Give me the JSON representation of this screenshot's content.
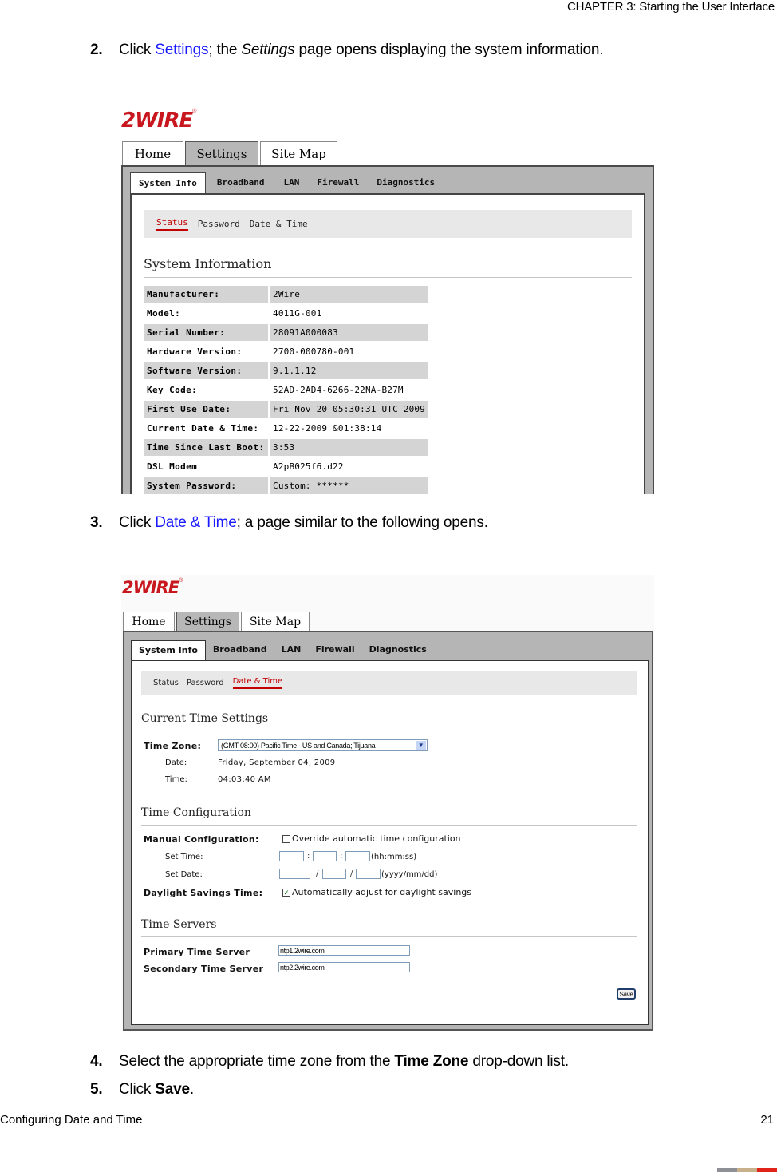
{
  "header": {
    "chapter": "CHAPTER 3: Starting the User Interface"
  },
  "steps": {
    "s2": {
      "num": "2.",
      "pre": "Click ",
      "link": "Settings",
      "mid": "; the ",
      "italic": "Settings",
      "post": " page opens displaying the system information."
    },
    "s3": {
      "num": "3.",
      "pre": "Click ",
      "link": "Date & Time",
      "post": "; a page similar to the following opens."
    },
    "s4": {
      "num": "4.",
      "pre": "Select the appropriate time zone from the ",
      "bold": "Time Zone",
      "post": " drop-down list."
    },
    "s5": {
      "num": "5.",
      "pre": "Click ",
      "bold": "Save",
      "post": "."
    }
  },
  "footer": {
    "left": "Configuring Date and Time",
    "page": "21",
    "bar_colors": [
      "#8f8f96",
      "#c8b08a",
      "#e2231a"
    ]
  },
  "brand": {
    "logo": "2WIRE",
    "reg": "®",
    "color": "#c8171e"
  },
  "screenshot1": {
    "top_tabs": [
      "Home",
      "Settings",
      "Site Map"
    ],
    "active_top_tab": "Settings",
    "sub_tabs": [
      "System Info",
      "Broadband",
      "LAN",
      "Firewall",
      "Diagnostics"
    ],
    "active_sub_tab": "System Info",
    "nav": [
      "Status",
      "Password",
      "Date & Time"
    ],
    "active_nav": "Status",
    "section_title": "System Information",
    "rows": [
      {
        "label": "Manufacturer:",
        "value": "2Wire"
      },
      {
        "label": "Model:",
        "value": "4011G-001"
      },
      {
        "label": "Serial Number:",
        "value": "28091A000083"
      },
      {
        "label": "Hardware Version:",
        "value": "2700-000780-001"
      },
      {
        "label": "Software Version:",
        "value": "9.1.1.12"
      },
      {
        "label": "Key Code:",
        "value": "52AD-2AD4-6266-22NA-B27M"
      },
      {
        "label": "First Use Date:",
        "value": "Fri Nov 20 05:30:31 UTC 2009"
      },
      {
        "label": "Current Date & Time:",
        "value": "12-22-2009 &01:38:14"
      },
      {
        "label": "Time Since Last Boot:",
        "value": "3:53"
      },
      {
        "label": "DSL Modem",
        "value": "A2pB025f6.d22"
      },
      {
        "label": "System Password:",
        "value": "Custom: ******"
      }
    ]
  },
  "screenshot2": {
    "top_tabs": [
      "Home",
      "Settings",
      "Site Map"
    ],
    "active_top_tab": "Settings",
    "sub_tabs": [
      "System Info",
      "Broadband",
      "LAN",
      "Firewall",
      "Diagnostics"
    ],
    "active_sub_tab": "System Info",
    "nav": [
      "Status",
      "Password",
      "Date & Time"
    ],
    "active_nav": "Date & Time",
    "current_time": {
      "title": "Current Time Settings",
      "time_zone_label": "Time Zone:",
      "time_zone_value": "(GMT-08:00) Pacific Time - US and Canada; Tijuana",
      "date_label": "Date:",
      "date_value": "Friday, September 04, 2009",
      "time_label": "Time:",
      "time_value": "04:03:40 AM"
    },
    "time_config": {
      "title": "Time Configuration",
      "manual_label": "Manual Configuration:",
      "override_label": "Override automatic time configuration",
      "override_checked": false,
      "set_time_label": "Set Time:",
      "time_sep": ":",
      "time_format": "(hh:mm:ss)",
      "set_date_label": "Set Date:",
      "date_sep": "/",
      "date_format": "(yyyy/mm/dd)",
      "dst_label": "Daylight Savings Time:",
      "dst_option": "Automatically adjust for daylight savings",
      "dst_checked": true,
      "check_glyph": "✓"
    },
    "time_servers": {
      "title": "Time Servers",
      "primary_label": "Primary Time Server",
      "primary_value": "ntp1.2wire.com",
      "secondary_label": "Secondary Time Server",
      "secondary_value": "ntp2.2wire.com"
    },
    "save_label": "Save"
  }
}
